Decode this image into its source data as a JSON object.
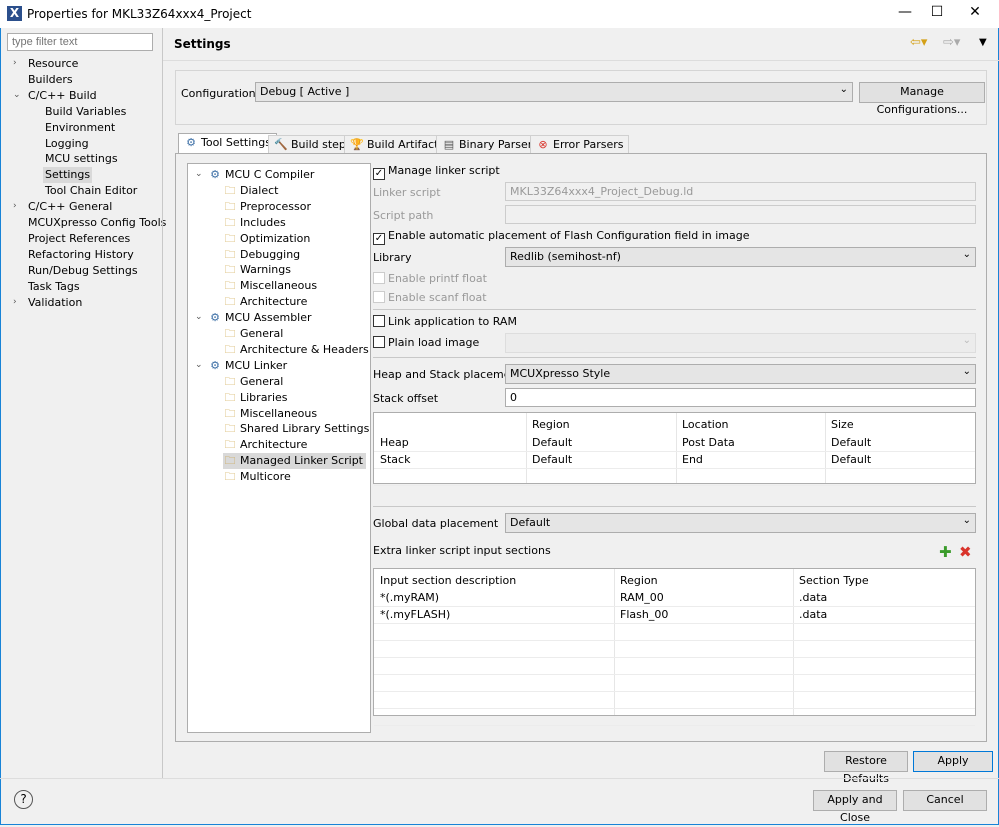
{
  "window": {
    "title": "Properties for MKL33Z64xxx4_Project"
  },
  "filter": {
    "placeholder": "type filter text"
  },
  "nav": [
    {
      "label": "Resource",
      "level": 0,
      "twisty": ">"
    },
    {
      "label": "Builders",
      "level": 0,
      "twisty": ""
    },
    {
      "label": "C/C++ Build",
      "level": 0,
      "twisty": "v"
    },
    {
      "label": "Build Variables",
      "level": 1,
      "twisty": ""
    },
    {
      "label": "Environment",
      "level": 1,
      "twisty": ""
    },
    {
      "label": "Logging",
      "level": 1,
      "twisty": ""
    },
    {
      "label": "MCU settings",
      "level": 1,
      "twisty": ""
    },
    {
      "label": "Settings",
      "level": 1,
      "twisty": "",
      "selected": true
    },
    {
      "label": "Tool Chain Editor",
      "level": 1,
      "twisty": ""
    },
    {
      "label": "C/C++ General",
      "level": 0,
      "twisty": ">"
    },
    {
      "label": "MCUXpresso Config Tools",
      "level": 0,
      "twisty": ""
    },
    {
      "label": "Project References",
      "level": 0,
      "twisty": ""
    },
    {
      "label": "Refactoring History",
      "level": 0,
      "twisty": ""
    },
    {
      "label": "Run/Debug Settings",
      "level": 0,
      "twisty": ""
    },
    {
      "label": "Task Tags",
      "level": 0,
      "twisty": ""
    },
    {
      "label": "Validation",
      "level": 0,
      "twisty": ">"
    }
  ],
  "header": {
    "title": "Settings"
  },
  "config": {
    "label": "Configuration:",
    "value": "Debug  [ Active ]",
    "manage_button": "Manage Configurations..."
  },
  "tabs": [
    {
      "label": "Tool Settings",
      "icon": "gear-icon"
    },
    {
      "label": "Build steps",
      "icon": "hammer-icon"
    },
    {
      "label": "Build Artifact",
      "icon": "trophy-icon"
    },
    {
      "label": "Binary Parsers",
      "icon": "binary-icon"
    },
    {
      "label": "Error Parsers",
      "icon": "error-icon"
    }
  ],
  "tool_tree": [
    {
      "label": "MCU C Compiler",
      "level": 0
    },
    {
      "label": "Dialect",
      "level": 1
    },
    {
      "label": "Preprocessor",
      "level": 1
    },
    {
      "label": "Includes",
      "level": 1
    },
    {
      "label": "Optimization",
      "level": 1
    },
    {
      "label": "Debugging",
      "level": 1
    },
    {
      "label": "Warnings",
      "level": 1
    },
    {
      "label": "Miscellaneous",
      "level": 1
    },
    {
      "label": "Architecture",
      "level": 1
    },
    {
      "label": "MCU Assembler",
      "level": 0
    },
    {
      "label": "General",
      "level": 1
    },
    {
      "label": "Architecture & Headers",
      "level": 1
    },
    {
      "label": "MCU Linker",
      "level": 0
    },
    {
      "label": "General",
      "level": 1
    },
    {
      "label": "Libraries",
      "level": 1
    },
    {
      "label": "Miscellaneous",
      "level": 1
    },
    {
      "label": "Shared Library Settings",
      "level": 1
    },
    {
      "label": "Architecture",
      "level": 1
    },
    {
      "label": "Managed Linker Script",
      "level": 1,
      "selected": true
    },
    {
      "label": "Multicore",
      "level": 1
    }
  ],
  "linker": {
    "manage_linker_script": {
      "label": "Manage linker script",
      "checked": true
    },
    "linker_script": {
      "label": "Linker script",
      "value": "MKL33Z64xxx4_Project_Debug.ld"
    },
    "script_path": {
      "label": "Script path",
      "value": ""
    },
    "auto_flash_config": {
      "label": "Enable automatic placement of Flash Configuration field in image",
      "checked": true
    },
    "library": {
      "label": "Library",
      "value": "Redlib (semihost-nf)"
    },
    "printf_float": {
      "label": "Enable printf float",
      "checked": false
    },
    "scanf_float": {
      "label": "Enable scanf float",
      "checked": false
    },
    "link_to_ram": {
      "label": "Link application to RAM",
      "checked": false
    },
    "plain_load": {
      "label": "Plain load image",
      "checked": false,
      "value": ""
    },
    "heap_stack": {
      "label": "Heap and Stack placement",
      "value": "MCUXpresso Style"
    },
    "stack_offset": {
      "label": "Stack offset",
      "value": "0"
    },
    "hs_table": {
      "columns": [
        "",
        "Region",
        "Location",
        "Size"
      ],
      "rows": [
        [
          "Heap",
          "Default",
          "Post Data",
          "Default"
        ],
        [
          "Stack",
          "Default",
          "End",
          "Default"
        ]
      ]
    },
    "global_data": {
      "label": "Global data placement",
      "value": "Default"
    },
    "extra_sections": {
      "label": "Extra linker script input sections",
      "columns": [
        "Input section description",
        "Region",
        "Section Type"
      ],
      "rows": [
        [
          "*(.myRAM)",
          "RAM_00",
          ".data"
        ],
        [
          "*(.myFLASH)",
          "Flash_00",
          ".data"
        ]
      ]
    }
  },
  "buttons": {
    "restore": "Restore Defaults",
    "apply": "Apply",
    "apply_close": "Apply and Close",
    "cancel": "Cancel"
  }
}
